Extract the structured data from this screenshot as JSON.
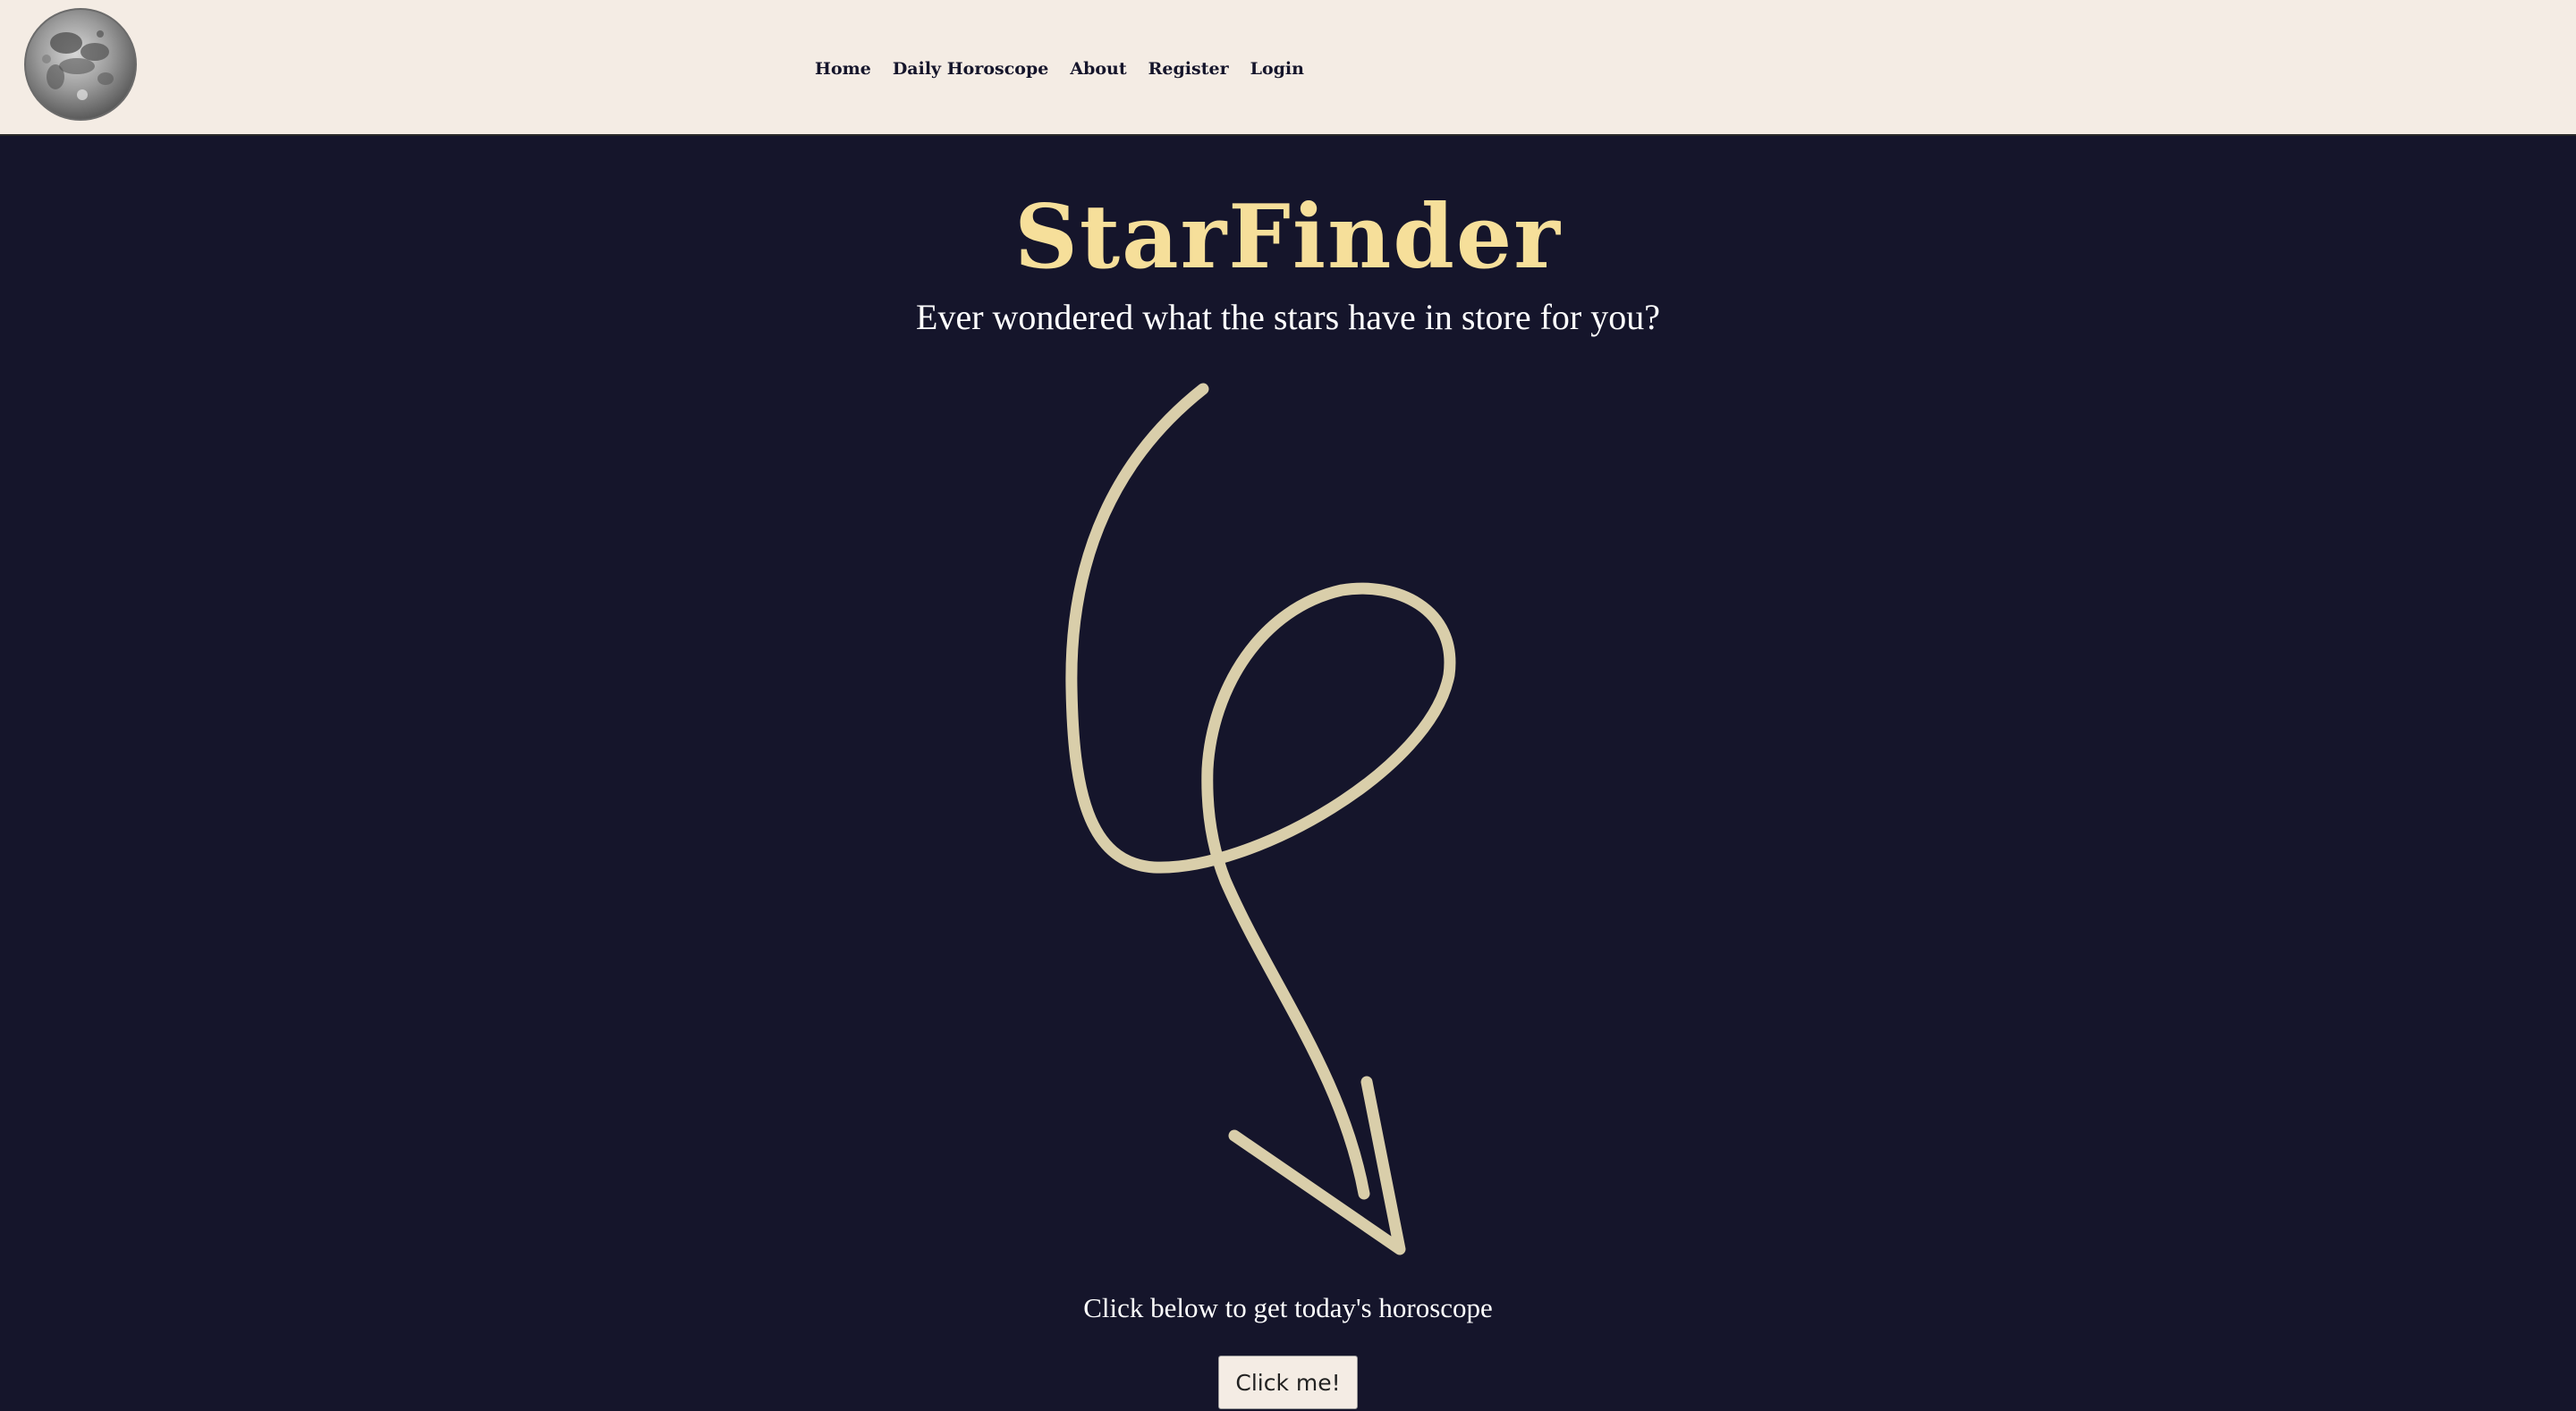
{
  "header": {
    "logo_icon": "moon-icon",
    "nav": [
      {
        "label": "Home"
      },
      {
        "label": "Daily Horoscope"
      },
      {
        "label": "About"
      },
      {
        "label": "Register"
      },
      {
        "label": "Login"
      }
    ]
  },
  "hero": {
    "title": "StarFinder",
    "subtitle": "Ever wondered what the stars have in store for you?",
    "arrow_icon": "hand-drawn-arrow-icon",
    "cta_text": "Click below to get today's horoscope",
    "cta_button_label": "Click me!"
  },
  "colors": {
    "header_bg": "#f4ece4",
    "page_bg": "#15152b",
    "title": "#f6df9a",
    "arrow": "#d9ceaa",
    "text": "#ffffff"
  }
}
